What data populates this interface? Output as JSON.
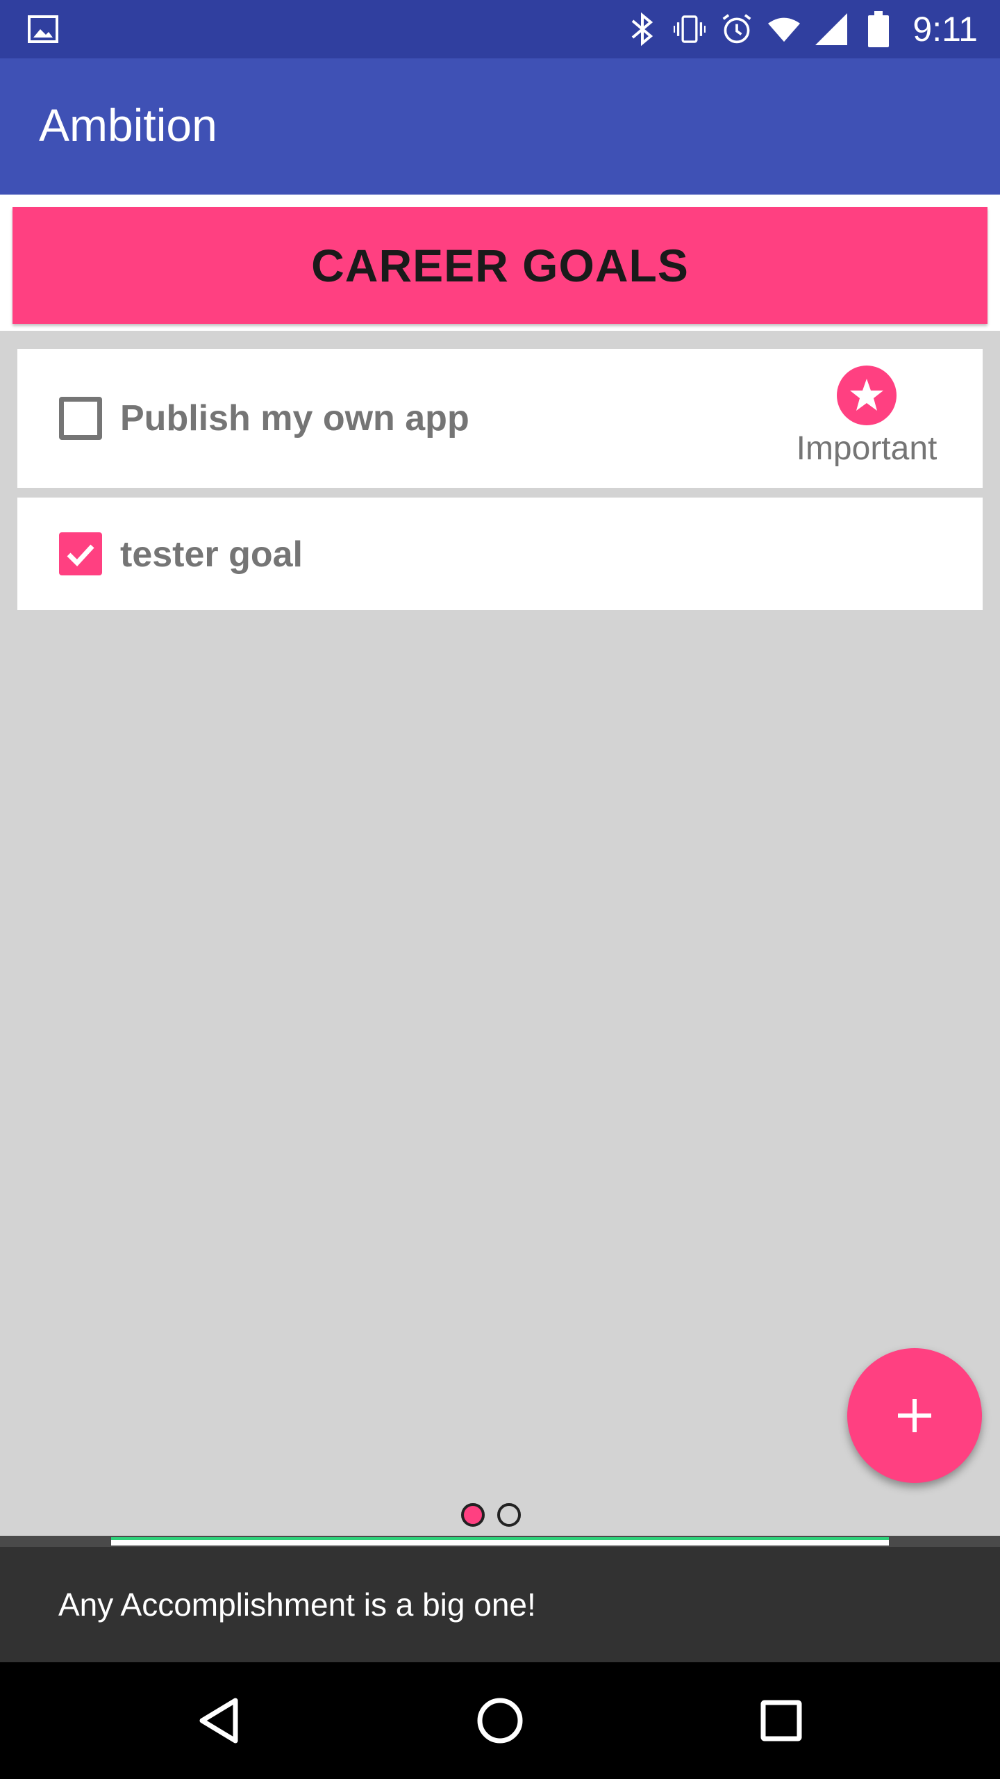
{
  "status_bar": {
    "time": "9:11",
    "icons": [
      "image-icon",
      "bluetooth-icon",
      "vibrate-icon",
      "alarm-icon",
      "wifi-icon",
      "signal-icon",
      "battery-icon"
    ]
  },
  "app_bar": {
    "title": "Ambition"
  },
  "category": {
    "title": "CAREER GOALS",
    "color": "#ff4081"
  },
  "goals": [
    {
      "text": "Publish my own app",
      "checked": false,
      "important": true,
      "important_label": "Important"
    },
    {
      "text": "tester goal",
      "checked": true,
      "important": false
    }
  ],
  "fab": {
    "icon": "add-icon"
  },
  "pager": {
    "pages": 2,
    "current": 1
  },
  "snackbar": {
    "message": "Any Accomplishment is a big one!"
  },
  "nav_bar": {
    "icons": [
      "back-icon",
      "home-icon",
      "recents-icon"
    ]
  },
  "colors": {
    "primary": "#3f51b5",
    "primary_dark": "#303f9f",
    "accent": "#ff4081"
  }
}
